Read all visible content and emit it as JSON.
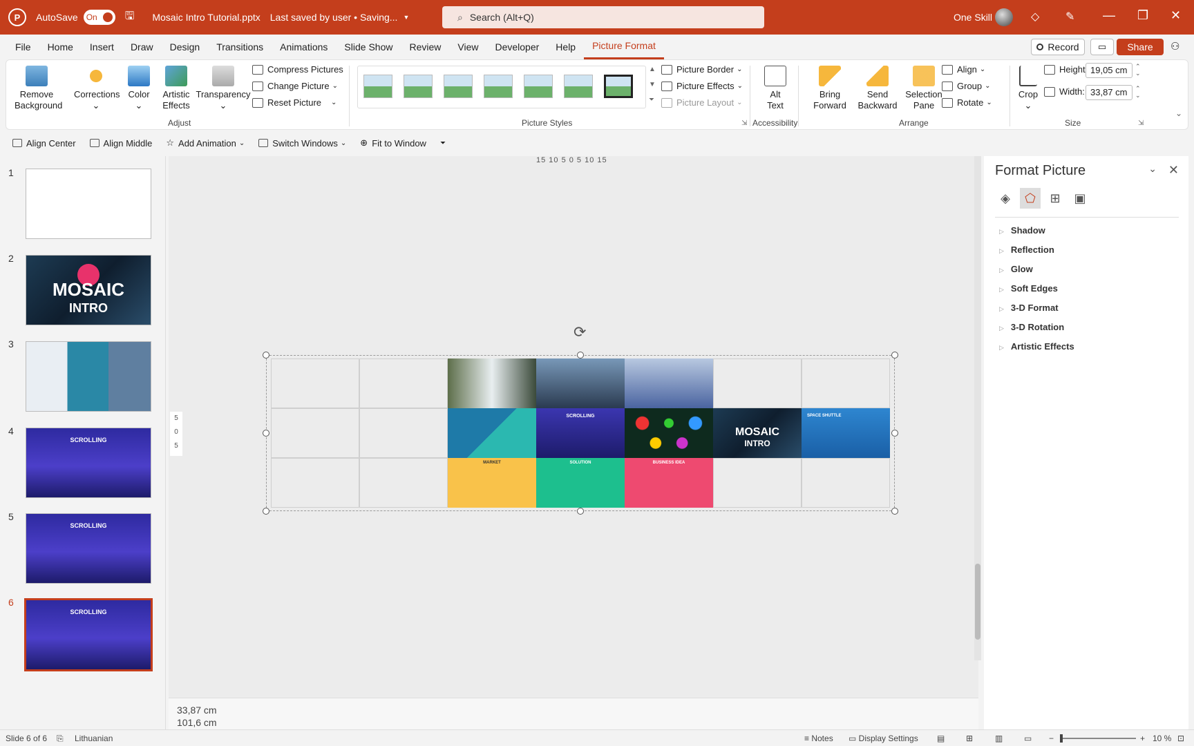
{
  "titlebar": {
    "autosave_label": "AutoSave",
    "autosave_state": "On",
    "doc_title": "Mosaic Intro Tutorial.pptx",
    "save_status": "Last saved by user • Saving...",
    "search_placeholder": "Search (Alt+Q)",
    "user_name": "One Skill",
    "accent": "#c43e1c"
  },
  "menu": [
    "File",
    "Home",
    "Insert",
    "Draw",
    "Design",
    "Transitions",
    "Animations",
    "Slide Show",
    "Review",
    "View",
    "Developer",
    "Help",
    "Picture Format"
  ],
  "actions": {
    "record": "Record",
    "share": "Share"
  },
  "ribbon": {
    "remove_bg": [
      "Remove",
      "Background"
    ],
    "corrections": "Corrections",
    "color": "Color",
    "artistic": [
      "Artistic",
      "Effects"
    ],
    "transparency": "Transparency",
    "compress": "Compress Pictures",
    "change": "Change Picture",
    "reset": "Reset Picture",
    "adjust_label": "Adjust",
    "styles_label": "Picture Styles",
    "picture_border": "Picture Border",
    "picture_effects": "Picture Effects",
    "picture_layout": "Picture Layout",
    "alt_text": [
      "Alt",
      "Text"
    ],
    "accessibility_label": "Accessibility",
    "bring_forward": [
      "Bring",
      "Forward"
    ],
    "send_backward": [
      "Send",
      "Backward"
    ],
    "selection_pane": [
      "Selection",
      "Pane"
    ],
    "align": "Align",
    "group": "Group",
    "rotate": "Rotate",
    "arrange_label": "Arrange",
    "crop": "Crop",
    "height_label": "Height:",
    "height_value": "19,05 cm",
    "width_label": "Width:",
    "width_value": "33,87 cm",
    "size_label": "Size"
  },
  "qat": [
    "Align Center",
    "Align Middle",
    "Add Animation",
    "Switch Windows",
    "Fit to Window"
  ],
  "slides": [
    {
      "num": "1"
    },
    {
      "num": "2",
      "title": "MOSAIC",
      "subtitle": "INTRO"
    },
    {
      "num": "3"
    },
    {
      "num": "4",
      "title": "SCROLLING"
    },
    {
      "num": "5",
      "title": "SCROLLING"
    },
    {
      "num": "6",
      "title": "SCROLLING"
    }
  ],
  "canvas": {
    "ruler_top": "15 10 5 0 5 10 15",
    "ruler_left": [
      "5",
      "0",
      "5"
    ],
    "tiles": {
      "scroll": "SCROLLING",
      "mosaic": "MOSAIC",
      "intro": "INTRO",
      "shuttle": "SPACE SHUTTLE",
      "market": "MARKET",
      "solution": "SOLUTION",
      "idea": "BUSINESS IDEA"
    },
    "notes_line1": "33,87 cm",
    "notes_line2": "101,6 cm"
  },
  "pane": {
    "title": "Format Picture",
    "sections": [
      "Shadow",
      "Reflection",
      "Glow",
      "Soft Edges",
      "3-D Format",
      "3-D Rotation",
      "Artistic Effects"
    ]
  },
  "status": {
    "slide": "Slide 6 of 6",
    "language": "Lithuanian",
    "notes": "Notes",
    "display": "Display Settings",
    "zoom": "10 %"
  }
}
